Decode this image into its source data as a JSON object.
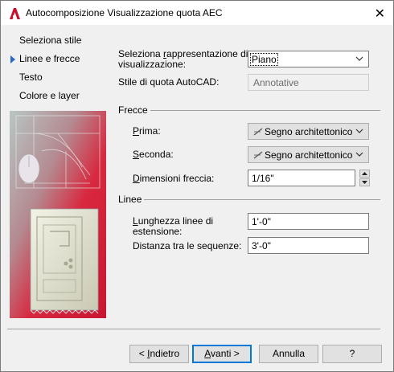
{
  "window": {
    "title": "Autocomposizione Visualizzazione quota AEC",
    "close_glyph": "✕"
  },
  "steps": [
    {
      "label": "Seleziona stile"
    },
    {
      "label": "Linee e frecce",
      "current": true
    },
    {
      "label": "Testo"
    },
    {
      "label": "Colore e layer"
    }
  ],
  "display": {
    "select_label_part1": "Seleziona ",
    "select_label_accel": "r",
    "select_label_part2": "appresentazione di",
    "select_label_line2": "visualizzazione:",
    "select_value": "Piano",
    "autocad_label": "Stile di quota AutoCAD:",
    "autocad_value": "Annotative"
  },
  "arrows": {
    "group_title": "Frecce",
    "first_accel": "P",
    "first_rest": "rima:",
    "first_value": "Segno architettonico",
    "second_accel": "S",
    "second_rest": "econda:",
    "second_value": "Segno architettonico",
    "size_accel": "D",
    "size_rest": "imensioni freccia:",
    "size_value": "1/16\""
  },
  "lines": {
    "group_title": "Linee",
    "ext_accel": "L",
    "ext_rest": "unghezza linee di",
    "ext_line2": "estensione:",
    "ext_value": "1'-0\"",
    "dist_label": "Distanza tra le sequenze:",
    "dist_value": "3'-0\""
  },
  "buttons": {
    "back_prefix": "< ",
    "back_accel": "I",
    "back_rest": "ndietro",
    "next_accel": "A",
    "next_rest": "vanti >",
    "cancel": "Annulla",
    "help": "?"
  },
  "colors": {
    "accent": "#0078d7",
    "step_arrow": "#2a6ac7",
    "illustration_red": "#d8283f"
  }
}
